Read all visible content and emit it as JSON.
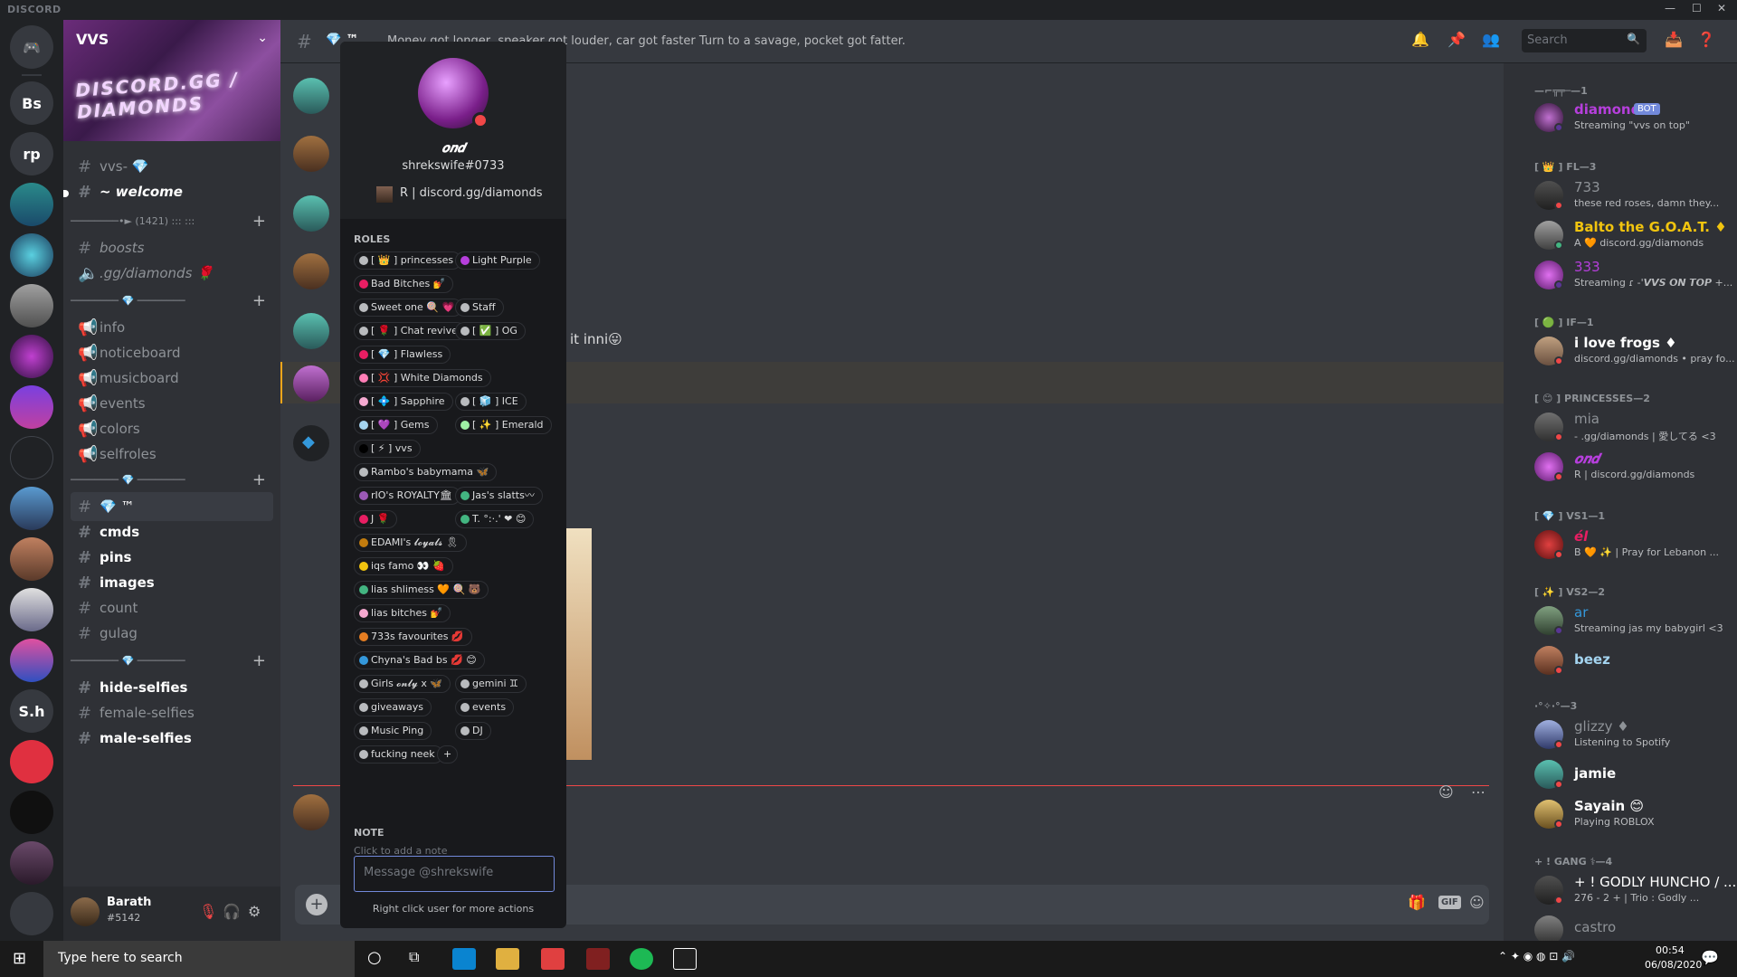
{
  "window": {
    "app_name": "DISCORD",
    "minimize": "—",
    "maximize": "☐",
    "close": "✕"
  },
  "server": {
    "name": "VVS",
    "banner_text": "DISCORD.GG / DIAMONDS",
    "channels": [
      {
        "label": "vvs- 💎",
        "type": "text"
      },
      {
        "label": "~ welcome",
        "type": "text",
        "bold": true
      },
      {
        "category": "────────•► (1421) ::: :::"
      },
      {
        "label": "boosts",
        "type": "text",
        "italic": true
      },
      {
        "label": ".gg/diamonds 🌹",
        "type": "voice",
        "italic": true
      },
      {
        "category": "──────── 💎 ────────"
      },
      {
        "label": "info",
        "type": "announce"
      },
      {
        "label": "noticeboard",
        "type": "announce"
      },
      {
        "label": "musicboard",
        "type": "announce"
      },
      {
        "label": "events",
        "type": "announce"
      },
      {
        "label": "colors",
        "type": "announce"
      },
      {
        "label": "selfroles",
        "type": "announce"
      },
      {
        "category": "──────── 💎 ────────"
      },
      {
        "label": "💎 ™",
        "type": "text",
        "active": true
      },
      {
        "label": "cmds",
        "type": "text",
        "bold": true
      },
      {
        "label": "pins",
        "type": "text",
        "bold": true
      },
      {
        "label": "images",
        "type": "text",
        "bold": true
      },
      {
        "label": "count",
        "type": "text"
      },
      {
        "label": "gulag",
        "type": "text"
      },
      {
        "category": "──────── 💎 ────────"
      },
      {
        "label": "hide-selfies",
        "type": "text",
        "bold": true
      },
      {
        "label": "female-selfies",
        "type": "text"
      },
      {
        "label": "male-selfies",
        "type": "text",
        "bold": true
      }
    ]
  },
  "user_panel": {
    "name": "Barath",
    "tag": "#5142"
  },
  "guilds": [
    "Bs",
    "rp",
    "S.h"
  ],
  "header": {
    "channel": "💎 ™",
    "topic": "Money got longer, speaker got louder, car got faster Turn to a savage, pocket got fatter.",
    "search_placeholder": "Search"
  },
  "chat": {
    "partial_message": "it inni😛",
    "input_placeholder": "Message @shrekswife"
  },
  "popout": {
    "display_name": "𝒐𝒏𝒅",
    "tag": "shrekswife#0733",
    "activity": "R | discord.gg/diamonds",
    "roles_label": "ROLES",
    "roles": [
      {
        "name": "[ 👑 ] princesses",
        "color": "#b9bbbe"
      },
      {
        "name": "Light Purple",
        "color": "#b63fdc"
      },
      {
        "name": "Bad Bitches 💅",
        "color": "#e91e63"
      },
      {
        "name": "Sweet one 🍭 💗",
        "color": "#b9bbbe"
      },
      {
        "name": "Staff",
        "color": "#b9bbbe"
      },
      {
        "name": "[ 🌹 ] Chat revive",
        "color": "#b9bbbe"
      },
      {
        "name": "[ ✅ ] OG",
        "color": "#b9bbbe"
      },
      {
        "name": "[ 💎 ] Flawless",
        "color": "#e91e63"
      },
      {
        "name": "[ 💢 ] White Diamonds",
        "color": "#ff7eb6"
      },
      {
        "name": "[ 💠 ] Sapphire",
        "color": "#f5a9d0"
      },
      {
        "name": "[ 🧊 ] ICE",
        "color": "#b9bbbe"
      },
      {
        "name": "[ 💜 ] Gems",
        "color": "#a4d4f0"
      },
      {
        "name": "[ ✨ ] Emerald",
        "color": "#9ef0a4"
      },
      {
        "name": "[ ⚡ ] vvs",
        "color": "#000000"
      },
      {
        "name": "Rambo's babymama 🦋",
        "color": "#b9bbbe"
      },
      {
        "name": "rIO's ROYALTY🏛",
        "color": "#9b59b6"
      },
      {
        "name": "Jas's slatts〰",
        "color": "#43b581"
      },
      {
        "name": "J 🌹",
        "color": "#e91e63"
      },
      {
        "name": "T. °:·.' ❤ 😊",
        "color": "#43b581"
      },
      {
        "name": "EDAMI's 𝓵𝓸𝔂𝓪𝓵𝓼 🎗",
        "color": "#c27c0e"
      },
      {
        "name": "iqs famo 👀 🍓",
        "color": "#f1c40f"
      },
      {
        "name": "lias shlimess 🧡 🍭 🐻",
        "color": "#43b581"
      },
      {
        "name": "lias bitches 💅",
        "color": "#f5a9d0"
      },
      {
        "name": "733s favourites 💋",
        "color": "#e67e22"
      },
      {
        "name": "Chyna's Bad bs 💋 😊",
        "color": "#3498db"
      },
      {
        "name": "Girls 𝓸𝓷𝓵𝔂 x 🦋",
        "color": "#b9bbbe"
      },
      {
        "name": "gemini ♊",
        "color": "#b9bbbe"
      },
      {
        "name": "giveaways",
        "color": "#b9bbbe"
      },
      {
        "name": "events",
        "color": "#b9bbbe"
      },
      {
        "name": "Music Ping",
        "color": "#b9bbbe"
      },
      {
        "name": "DJ",
        "color": "#b9bbbe"
      },
      {
        "name": "fucking neek",
        "color": "#b9bbbe"
      }
    ],
    "add_role": "+",
    "note_label": "NOTE",
    "note_placeholder": "Click to add a note",
    "message_placeholder": "Message @shrekswife",
    "hint": "Right click user for more actions"
  },
  "members": {
    "groups": [
      {
        "label": "—⌐╦╤─—1",
        "members": [
          {
            "name": "diamond",
            "badge": "BOT",
            "status": "Streaming \"vvs on top\"",
            "color": "#b63fdc"
          }
        ]
      },
      {
        "label": "[ 👑 ] FL—3",
        "members": [
          {
            "name": "733",
            "status": "these red roses, damn they...",
            "color": "#8e9297"
          },
          {
            "name": "Balto the G.O.A.T. ♦",
            "status": "A 🧡 discord.gg/diamonds",
            "color": "#f1c40f"
          },
          {
            "name": "333",
            "status": "Streaming ɾ -'𝙑𝙑𝙎 𝙊𝙉 𝙏𝙊𝙋 +...",
            "color": "#b63fdc"
          }
        ]
      },
      {
        "label": "[ 🟢 ] IF—1",
        "members": [
          {
            "name": "i love frogs ♦",
            "status": "discord.gg/diamonds • pray fo...",
            "color": "#ffffff"
          }
        ]
      },
      {
        "label": "[ 😊 ] PRINCESSES—2",
        "members": [
          {
            "name": "mia",
            "status": "- .gg/diamonds | 愛してる <3",
            "color": "#8e9297"
          },
          {
            "name": "𝒐𝒏𝒅",
            "status": "R | discord.gg/diamonds",
            "color": "#b63fdc"
          }
        ]
      },
      {
        "label": "[ 💎 ] VS1—1",
        "members": [
          {
            "name": "él",
            "status": "B 🧡 ✨ | Pray for Lebanon ...",
            "color": "#e91e63"
          }
        ]
      },
      {
        "label": "[ ✨ ] VS2—2",
        "members": [
          {
            "name": "ar",
            "status": "Streaming jas my babygirl <3",
            "color": "#3498db"
          },
          {
            "name": "beez",
            "status": "",
            "color": "#a4d4f0"
          }
        ]
      },
      {
        "label": "·°✧·°—3",
        "members": [
          {
            "name": "glizzy ♦",
            "status": "Listening to Spotify",
            "color": "#8e9297"
          },
          {
            "name": "jamie",
            "status": "",
            "color": "#ffffff"
          },
          {
            "name": "Sayain 😊",
            "status": "Playing ROBLOX",
            "color": "#ffffff"
          }
        ]
      },
      {
        "label": "+ ! GANG ⚕—4",
        "members": [
          {
            "name": "+ ! GODLY HUNCHO / ...",
            "status": "276 - 2 + | Trio : Godly ...",
            "color": "#ffffff"
          },
          {
            "name": "castro",
            "status": "",
            "color": "#8e9297"
          }
        ]
      }
    ]
  },
  "taskbar": {
    "search_placeholder": "Type here to search",
    "time": "00:54",
    "date": "06/08/2020"
  },
  "colors": {
    "blurple": "#7289da",
    "online": "#43b581",
    "dnd": "#f04747"
  }
}
